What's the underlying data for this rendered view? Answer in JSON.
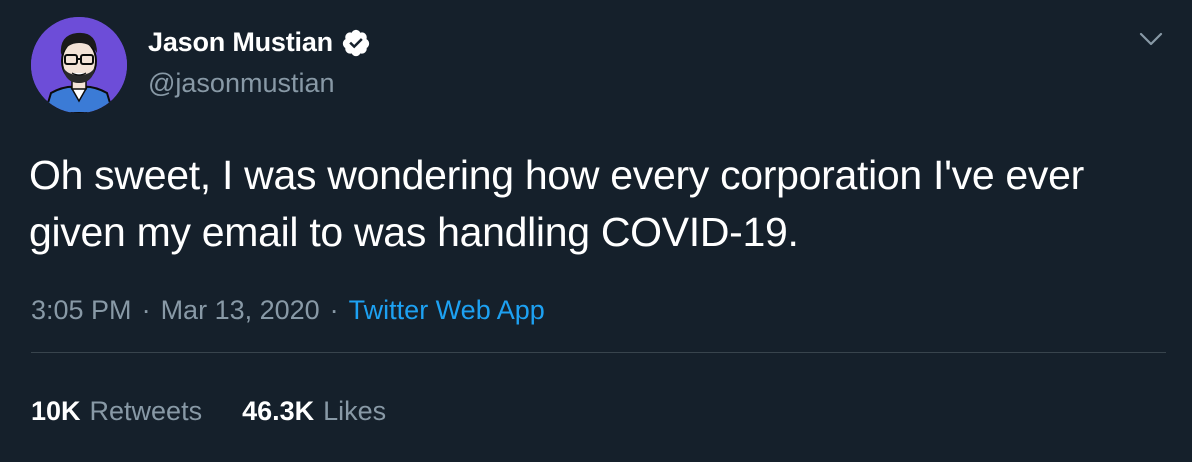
{
  "user": {
    "display_name": "Jason Mustian",
    "handle": "@jasonmustian",
    "verified": true
  },
  "tweet": {
    "text": "Oh sweet, I was wondering how every corporation I've ever given my email to was handling COVID-19.",
    "time": "3:05 PM",
    "separator": "·",
    "date": "Mar 13, 2020",
    "source": "Twitter Web App"
  },
  "stats": {
    "retweets_count": "10K",
    "retweets_label": "Retweets",
    "likes_count": "46.3K",
    "likes_label": "Likes"
  },
  "icons": {
    "avatar": "avatar-illustration",
    "verified": "verified-badge-icon",
    "menu": "chevron-down-icon"
  },
  "colors": {
    "background": "#15202b",
    "text_primary": "#ffffff",
    "text_secondary": "#8899a6",
    "link": "#1da1f2",
    "divider": "#38444d",
    "avatar_bg": "#6d4dd8"
  }
}
